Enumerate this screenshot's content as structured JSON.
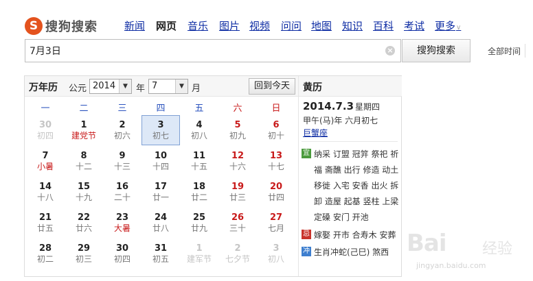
{
  "logo": {
    "mark": "S",
    "text": "搜狗搜索"
  },
  "nav": {
    "items": [
      {
        "label": "新闻",
        "active": false
      },
      {
        "label": "网页",
        "active": true
      },
      {
        "label": "音乐",
        "active": false
      },
      {
        "label": "图片",
        "active": false
      },
      {
        "label": "视频",
        "active": false
      },
      {
        "label": "问问",
        "active": false
      },
      {
        "label": "地图",
        "active": false
      },
      {
        "label": "知识",
        "active": false
      },
      {
        "label": "百科",
        "active": false
      },
      {
        "label": "考试",
        "active": false
      }
    ],
    "more_label": "更多"
  },
  "search": {
    "value": "7月3日",
    "button_label": "搜狗搜索",
    "time_filter": "全部时间"
  },
  "calendar": {
    "title": "万年历",
    "era_label": "公元",
    "year": "2014",
    "year_suffix": "年",
    "month": "7",
    "month_suffix": "月",
    "today_button": "回到今天",
    "weekdays": [
      "一",
      "二",
      "三",
      "四",
      "五",
      "六",
      "日"
    ],
    "weeks": [
      [
        {
          "day": "30",
          "lunar": "初四",
          "type": "other"
        },
        {
          "day": "1",
          "lunar": "建党节",
          "type": "fest"
        },
        {
          "day": "2",
          "lunar": "初六"
        },
        {
          "day": "3",
          "lunar": "初七",
          "type": "selected"
        },
        {
          "day": "4",
          "lunar": "初八"
        },
        {
          "day": "5",
          "lunar": "初九",
          "type": "wk"
        },
        {
          "day": "6",
          "lunar": "初十",
          "type": "wk"
        }
      ],
      [
        {
          "day": "7",
          "lunar": "小暑",
          "type": "fest"
        },
        {
          "day": "8",
          "lunar": "十二"
        },
        {
          "day": "9",
          "lunar": "十三"
        },
        {
          "day": "10",
          "lunar": "十四"
        },
        {
          "day": "11",
          "lunar": "十五"
        },
        {
          "day": "12",
          "lunar": "十六",
          "type": "wk"
        },
        {
          "day": "13",
          "lunar": "十七",
          "type": "wk"
        }
      ],
      [
        {
          "day": "14",
          "lunar": "十八"
        },
        {
          "day": "15",
          "lunar": "十九"
        },
        {
          "day": "16",
          "lunar": "二十"
        },
        {
          "day": "17",
          "lunar": "廿一"
        },
        {
          "day": "18",
          "lunar": "廿二"
        },
        {
          "day": "19",
          "lunar": "廿三",
          "type": "wk"
        },
        {
          "day": "20",
          "lunar": "廿四",
          "type": "wk"
        }
      ],
      [
        {
          "day": "21",
          "lunar": "廿五"
        },
        {
          "day": "22",
          "lunar": "廿六"
        },
        {
          "day": "23",
          "lunar": "大暑",
          "type": "fest"
        },
        {
          "day": "24",
          "lunar": "廿八"
        },
        {
          "day": "25",
          "lunar": "廿九"
        },
        {
          "day": "26",
          "lunar": "三十",
          "type": "wk"
        },
        {
          "day": "27",
          "lunar": "七月",
          "type": "wk"
        }
      ],
      [
        {
          "day": "28",
          "lunar": "初二"
        },
        {
          "day": "29",
          "lunar": "初三"
        },
        {
          "day": "30",
          "lunar": "初四"
        },
        {
          "day": "31",
          "lunar": "初五"
        },
        {
          "day": "1",
          "lunar": "建军节",
          "type": "other"
        },
        {
          "day": "2",
          "lunar": "七夕节",
          "type": "other"
        },
        {
          "day": "3",
          "lunar": "初八",
          "type": "other"
        }
      ]
    ]
  },
  "almanac": {
    "title": "黄历",
    "date": "2014.7.3",
    "weekday": "星期四",
    "ganzhi": "甲午(马)年 六月初七",
    "zodiac": "巨蟹座",
    "yi_badge": "宜",
    "yi_lines": [
      "纳采 订盟 冠笄 祭祀 祈",
      "福 斋醮 出行 修造 动土",
      "移徙 入宅 安香 出火 拆",
      "卸 造屋 起基 竖柱 上梁",
      "定磉 安门 开池"
    ],
    "ji_badge": "忌",
    "ji_line": "嫁娶 开市 合寿木 安葬",
    "chong_badge": "冲",
    "chong_line": "生肖冲蛇(己巳) 煞西"
  },
  "watermark": {
    "logo": "Bai",
    "text": "经验",
    "url": "jingyan.baidu.com"
  }
}
